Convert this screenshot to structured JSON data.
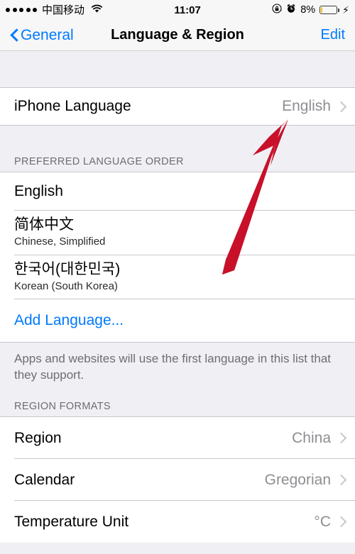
{
  "status_bar": {
    "signal_dots": 5,
    "carrier": "中国移动",
    "wifi_icon": "wifi-icon",
    "time": "11:07",
    "rotation_lock_icon": "rotation-lock-icon",
    "alarm_icon": "alarm-clock-icon",
    "battery_percent": "8%",
    "battery_level": 8,
    "battery_charging": true,
    "battery_fill_color": "#f6c500"
  },
  "nav": {
    "back_label": "General",
    "back_icon": "chevron-left-icon",
    "title": "Language & Region",
    "edit_label": "Edit"
  },
  "sections": {
    "iphone_language": {
      "row": {
        "title": "iPhone Language",
        "value": "English",
        "chevron": "chevron-right-icon"
      }
    },
    "preferred_language_order": {
      "header": "PREFERRED LANGUAGE ORDER",
      "items": [
        {
          "main": "English",
          "sub": ""
        },
        {
          "main": "简体中文",
          "sub": "Chinese, Simplified"
        },
        {
          "main": "한국어(대한민국)",
          "sub": "Korean (South Korea)"
        }
      ],
      "action": "Add Language...",
      "footer": "Apps and websites will use the first language in this list that they support."
    },
    "region_formats": {
      "header": "REGION FORMATS",
      "rows": [
        {
          "title": "Region",
          "value": "China",
          "chevron": "chevron-right-icon"
        },
        {
          "title": "Calendar",
          "value": "Gregorian",
          "chevron": "chevron-right-icon"
        },
        {
          "title": "Temperature Unit",
          "value": "°C",
          "chevron": "chevron-right-icon"
        }
      ]
    }
  },
  "annotation": {
    "arrow_color": "#c8102a",
    "arrow_target": "iPhone Language value — English"
  },
  "colors": {
    "accent_blue": "#007aff",
    "background": "#efeff4",
    "row_background": "#ffffff",
    "separator": "#c8c7cc",
    "secondary_text": "#8e8e93",
    "header_text": "#6d6d72"
  }
}
